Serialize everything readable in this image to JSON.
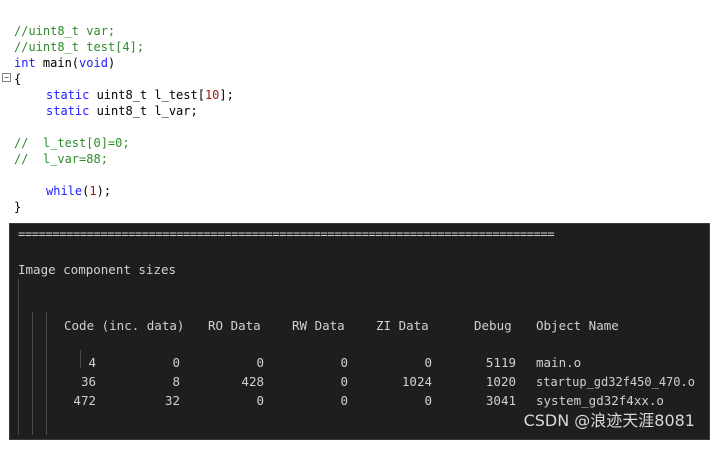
{
  "editor": {
    "line1": "//uint8_t var;",
    "line2": "//uint8_t test[4];",
    "line3_kw": "int",
    "line3_text": " main(",
    "line3_kw2": "void",
    "line3_end": ")",
    "line4": "{",
    "line5_kw": "static",
    "line5_text": " uint8_t l_test[",
    "line5_num": "10",
    "line5_end": "];",
    "line6_kw": "static",
    "line6_text": " uint8_t l_var;",
    "line7": "//  l_test[0]=0;",
    "line8": "//  l_var=88;",
    "line9_kw": "while",
    "line9_text": "(",
    "line9_num": "1",
    "line9_end": ");",
    "line10": "}",
    "fold_symbol": "−"
  },
  "terminal": {
    "separator": "==============================================================================",
    "title": "Image component sizes",
    "headers": [
      "Code (inc. data)",
      "RO Data",
      "RW Data",
      "ZI Data",
      "Debug",
      "Object Name"
    ],
    "rows": [
      {
        "code": "4",
        "inc": "0",
        "ro": "0",
        "rw": "0",
        "zi": "0",
        "debug": "5119",
        "name": "main.o"
      },
      {
        "code": "36",
        "inc": "8",
        "ro": "428",
        "rw": "0",
        "zi": "1024",
        "debug": "1020",
        "name": "startup_gd32f450_470.o"
      },
      {
        "code": "472",
        "inc": "32",
        "ro": "0",
        "rw": "0",
        "zi": "0",
        "debug": "3041",
        "name": "system_gd32f4xx.o"
      }
    ]
  },
  "watermark": "CSDN @浪迹天涯8081"
}
